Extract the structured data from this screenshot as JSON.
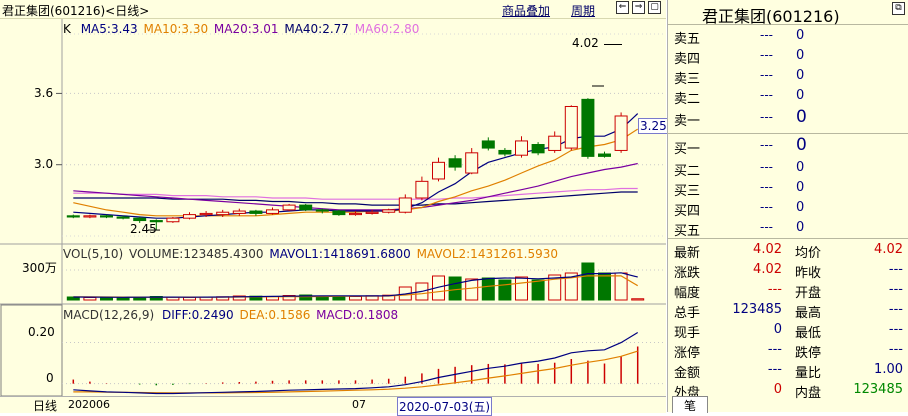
{
  "window": {
    "stock_title": "君正集团(601216)<日线>",
    "menu_overlay": "商品叠加",
    "menu_period": "周期"
  },
  "price_panel": {
    "k_label": "K",
    "ma5": "MA5:3.43",
    "ma10": "MA10:3.30",
    "ma20": "MA20:3.01",
    "ma40": "MA40:2.77",
    "ma60": "MA60:2.80",
    "max_label": "4.02",
    "min_label": "2.45",
    "current_price_tag": "3.25",
    "y_ticks": [
      "3.6",
      "3.0"
    ]
  },
  "volume_panel": {
    "title": "VOL(5,10)",
    "volume": "VOLUME:123485.4300",
    "mavol1": "MAVOL1:1418691.6800",
    "mavol2": "MAVOL2:1431261.5930",
    "y_tick": "300万"
  },
  "macd_panel": {
    "title": "MACD(12,26,9)",
    "diff": "DIFF:0.2490",
    "dea": "DEA:0.1586",
    "macd": "MACD:0.1808",
    "y_ticks": [
      "0.20",
      "0"
    ]
  },
  "x_axis": {
    "period_label": "日线",
    "start_label": "202006",
    "mid_label": "07",
    "cursor_date": "2020-07-03(五)"
  },
  "quote": {
    "title": "君正集团(601216)",
    "sell": [
      {
        "label": "卖五",
        "price": "---",
        "vol": "0"
      },
      {
        "label": "卖四",
        "price": "---",
        "vol": "0"
      },
      {
        "label": "卖三",
        "price": "---",
        "vol": "0"
      },
      {
        "label": "卖二",
        "price": "---",
        "vol": "0"
      },
      {
        "label": "卖一",
        "price": "---",
        "vol": "0"
      }
    ],
    "buy": [
      {
        "label": "买一",
        "price": "---",
        "vol": "0"
      },
      {
        "label": "买二",
        "price": "---",
        "vol": "0"
      },
      {
        "label": "买三",
        "price": "---",
        "vol": "0"
      },
      {
        "label": "买四",
        "price": "---",
        "vol": "0"
      },
      {
        "label": "买五",
        "price": "---",
        "vol": "0"
      }
    ],
    "stats": [
      {
        "l1": "最新",
        "v1": "4.02",
        "c1": "red",
        "l2": "均价",
        "v2": "4.02",
        "c2": "red"
      },
      {
        "l1": "涨跌",
        "v1": "4.02",
        "c1": "red",
        "l2": "昨收",
        "v2": "---",
        "c2": "navy"
      },
      {
        "l1": "幅度",
        "v1": "---",
        "c1": "red",
        "l2": "开盘",
        "v2": "---",
        "c2": "navy"
      },
      {
        "l1": "总手",
        "v1": "123485",
        "c1": "navy",
        "l2": "最高",
        "v2": "---",
        "c2": "navy"
      },
      {
        "l1": "现手",
        "v1": "0",
        "c1": "navy",
        "l2": "最低",
        "v2": "---",
        "c2": "navy"
      },
      {
        "l1": "涨停",
        "v1": "---",
        "c1": "navy",
        "l2": "跌停",
        "v2": "---",
        "c2": "navy"
      },
      {
        "l1": "金额",
        "v1": "---",
        "c1": "navy",
        "l2": "量比",
        "v2": "1.00",
        "c2": "navy"
      },
      {
        "l1": "外盘",
        "v1": "0",
        "c1": "red",
        "l2": "内盘",
        "v2": "123485",
        "c2": "green"
      }
    ],
    "bottom_tab": "笔"
  },
  "chart_data": {
    "type": "candlestick",
    "x_range_label": [
      "202006",
      "07"
    ],
    "ylim": [
      2.4,
      4.1
    ],
    "candles": [
      {
        "o": 2.57,
        "c": 2.56,
        "h": 2.58,
        "l": 2.55
      },
      {
        "o": 2.56,
        "c": 2.57,
        "h": 2.58,
        "l": 2.55
      },
      {
        "o": 2.57,
        "c": 2.56,
        "h": 2.58,
        "l": 2.55
      },
      {
        "o": 2.56,
        "c": 2.55,
        "h": 2.57,
        "l": 2.54
      },
      {
        "o": 2.55,
        "c": 2.53,
        "h": 2.56,
        "l": 2.51
      },
      {
        "o": 2.53,
        "c": 2.52,
        "h": 2.54,
        "l": 2.45
      },
      {
        "o": 2.52,
        "c": 2.55,
        "h": 2.56,
        "l": 2.51
      },
      {
        "o": 2.55,
        "c": 2.58,
        "h": 2.6,
        "l": 2.54
      },
      {
        "o": 2.58,
        "c": 2.59,
        "h": 2.61,
        "l": 2.56
      },
      {
        "o": 2.58,
        "c": 2.6,
        "h": 2.62,
        "l": 2.56
      },
      {
        "o": 2.59,
        "c": 2.61,
        "h": 2.63,
        "l": 2.57
      },
      {
        "o": 2.61,
        "c": 2.59,
        "h": 2.62,
        "l": 2.57
      },
      {
        "o": 2.59,
        "c": 2.62,
        "h": 2.64,
        "l": 2.58
      },
      {
        "o": 2.62,
        "c": 2.66,
        "h": 2.67,
        "l": 2.61
      },
      {
        "o": 2.66,
        "c": 2.62,
        "h": 2.67,
        "l": 2.61
      },
      {
        "o": 2.62,
        "c": 2.61,
        "h": 2.63,
        "l": 2.59
      },
      {
        "o": 2.61,
        "c": 2.58,
        "h": 2.62,
        "l": 2.57
      },
      {
        "o": 2.58,
        "c": 2.59,
        "h": 2.61,
        "l": 2.57
      },
      {
        "o": 2.59,
        "c": 2.6,
        "h": 2.62,
        "l": 2.58
      },
      {
        "o": 2.6,
        "c": 2.62,
        "h": 2.63,
        "l": 2.59
      },
      {
        "o": 2.6,
        "c": 2.72,
        "h": 2.75,
        "l": 2.59
      },
      {
        "o": 2.72,
        "c": 2.86,
        "h": 2.9,
        "l": 2.7
      },
      {
        "o": 2.88,
        "c": 3.02,
        "h": 3.06,
        "l": 2.86
      },
      {
        "o": 3.05,
        "c": 2.98,
        "h": 3.08,
        "l": 2.95
      },
      {
        "o": 2.93,
        "c": 3.1,
        "h": 3.14,
        "l": 2.92
      },
      {
        "o": 3.2,
        "c": 3.14,
        "h": 3.23,
        "l": 3.12
      },
      {
        "o": 3.12,
        "c": 3.09,
        "h": 3.14,
        "l": 3.07
      },
      {
        "o": 3.08,
        "c": 3.2,
        "h": 3.24,
        "l": 3.06
      },
      {
        "o": 3.17,
        "c": 3.1,
        "h": 3.19,
        "l": 3.08
      },
      {
        "o": 3.12,
        "c": 3.24,
        "h": 3.28,
        "l": 3.1
      },
      {
        "o": 3.14,
        "c": 3.49,
        "h": 3.5,
        "l": 3.12
      },
      {
        "o": 3.55,
        "c": 3.07,
        "h": 3.56,
        "l": 3.05
      },
      {
        "o": 3.09,
        "c": 3.07,
        "h": 3.11,
        "l": 3.06
      },
      {
        "o": 3.12,
        "c": 3.41,
        "h": 3.44,
        "l": 3.1
      }
    ],
    "ma5": [
      2.6,
      2.59,
      2.58,
      2.57,
      2.56,
      2.55,
      2.55,
      2.56,
      2.57,
      2.58,
      2.59,
      2.6,
      2.6,
      2.61,
      2.62,
      2.62,
      2.61,
      2.61,
      2.61,
      2.61,
      2.63,
      2.68,
      2.77,
      2.84,
      2.94,
      3.02,
      3.06,
      3.1,
      3.13,
      3.15,
      3.22,
      3.24,
      3.24,
      3.3,
      3.43
    ],
    "ma10": [
      2.68,
      2.65,
      2.62,
      2.6,
      2.58,
      2.57,
      2.57,
      2.57,
      2.57,
      2.57,
      2.57,
      2.57,
      2.58,
      2.59,
      2.6,
      2.6,
      2.6,
      2.6,
      2.61,
      2.61,
      2.62,
      2.64,
      2.69,
      2.73,
      2.78,
      2.82,
      2.87,
      2.93,
      2.99,
      3.04,
      3.12,
      3.15,
      3.17,
      3.21,
      3.3
    ],
    "ma20": [
      2.78,
      2.77,
      2.76,
      2.75,
      2.74,
      2.73,
      2.72,
      2.71,
      2.7,
      2.69,
      2.68,
      2.67,
      2.66,
      2.65,
      2.64,
      2.63,
      2.62,
      2.62,
      2.62,
      2.62,
      2.63,
      2.64,
      2.66,
      2.68,
      2.7,
      2.73,
      2.76,
      2.79,
      2.82,
      2.86,
      2.9,
      2.93,
      2.96,
      2.98,
      3.01
    ],
    "ma40": [
      2.72,
      2.72,
      2.72,
      2.72,
      2.72,
      2.72,
      2.71,
      2.71,
      2.71,
      2.71,
      2.7,
      2.7,
      2.69,
      2.69,
      2.68,
      2.68,
      2.67,
      2.67,
      2.66,
      2.66,
      2.66,
      2.66,
      2.67,
      2.67,
      2.68,
      2.69,
      2.7,
      2.71,
      2.72,
      2.73,
      2.74,
      2.75,
      2.76,
      2.77,
      2.77
    ],
    "ma60": [
      2.76,
      2.76,
      2.76,
      2.75,
      2.75,
      2.75,
      2.74,
      2.74,
      2.74,
      2.73,
      2.73,
      2.73,
      2.72,
      2.72,
      2.72,
      2.71,
      2.71,
      2.71,
      2.71,
      2.71,
      2.71,
      2.71,
      2.71,
      2.72,
      2.72,
      2.73,
      2.74,
      2.75,
      2.76,
      2.77,
      2.78,
      2.79,
      2.79,
      2.8,
      2.8
    ],
    "volume_ylim": [
      0,
      4000000
    ],
    "volumes": [
      300000,
      250000,
      280000,
      220000,
      300000,
      350000,
      280000,
      260000,
      300000,
      320000,
      400000,
      380000,
      350000,
      450000,
      500000,
      400000,
      380000,
      350000,
      420000,
      480000,
      1300000,
      1700000,
      2400000,
      2300000,
      2100000,
      2200000,
      2000000,
      2300000,
      2000000,
      2500000,
      2700000,
      3700000,
      2700000,
      2700000,
      123485
    ],
    "mavol1": [
      300000,
      290000,
      280000,
      270000,
      280000,
      290000,
      290000,
      280000,
      290000,
      300000,
      320000,
      340000,
      360000,
      380000,
      400000,
      410000,
      420000,
      410000,
      410000,
      420000,
      600000,
      860000,
      1280000,
      1640000,
      1960000,
      2140000,
      2200000,
      2180000,
      2120000,
      2200000,
      2300000,
      2640000,
      2640000,
      2720000,
      2300000
    ],
    "mavol2": [
      320000,
      310000,
      300000,
      290000,
      290000,
      290000,
      290000,
      290000,
      290000,
      290000,
      300000,
      310000,
      320000,
      330000,
      340000,
      350000,
      370000,
      380000,
      390000,
      400000,
      500000,
      630000,
      830000,
      1030000,
      1180000,
      1370000,
      1520000,
      1700000,
      1880000,
      2080000,
      2220000,
      2420000,
      2410000,
      2420000,
      1431262
    ],
    "macd_ylim": [
      -0.06,
      0.3
    ],
    "diff": [
      -0.03,
      -0.035,
      -0.04,
      -0.042,
      -0.045,
      -0.048,
      -0.048,
      -0.046,
      -0.044,
      -0.042,
      -0.04,
      -0.038,
      -0.035,
      -0.032,
      -0.03,
      -0.028,
      -0.026,
      -0.024,
      -0.02,
      -0.015,
      -0.005,
      0.01,
      0.03,
      0.045,
      0.06,
      0.075,
      0.085,
      0.1,
      0.11,
      0.125,
      0.15,
      0.16,
      0.165,
      0.2,
      0.249
    ],
    "dea": [
      -0.04,
      -0.04,
      -0.041,
      -0.042,
      -0.043,
      -0.044,
      -0.045,
      -0.045,
      -0.045,
      -0.045,
      -0.044,
      -0.043,
      -0.042,
      -0.04,
      -0.038,
      -0.036,
      -0.034,
      -0.032,
      -0.03,
      -0.027,
      -0.022,
      -0.015,
      -0.006,
      0.004,
      0.015,
      0.027,
      0.038,
      0.05,
      0.062,
      0.074,
      0.09,
      0.104,
      0.116,
      0.133,
      0.1586
    ],
    "macd": [
      0.02,
      0.01,
      0.002,
      0.0,
      -0.004,
      -0.008,
      -0.006,
      -0.002,
      0.002,
      0.006,
      0.008,
      0.01,
      0.014,
      0.016,
      0.016,
      0.016,
      0.016,
      0.016,
      0.02,
      0.024,
      0.034,
      0.05,
      0.072,
      0.082,
      0.09,
      0.096,
      0.094,
      0.1,
      0.096,
      0.102,
      0.12,
      0.112,
      0.098,
      0.134,
      0.1808
    ]
  }
}
